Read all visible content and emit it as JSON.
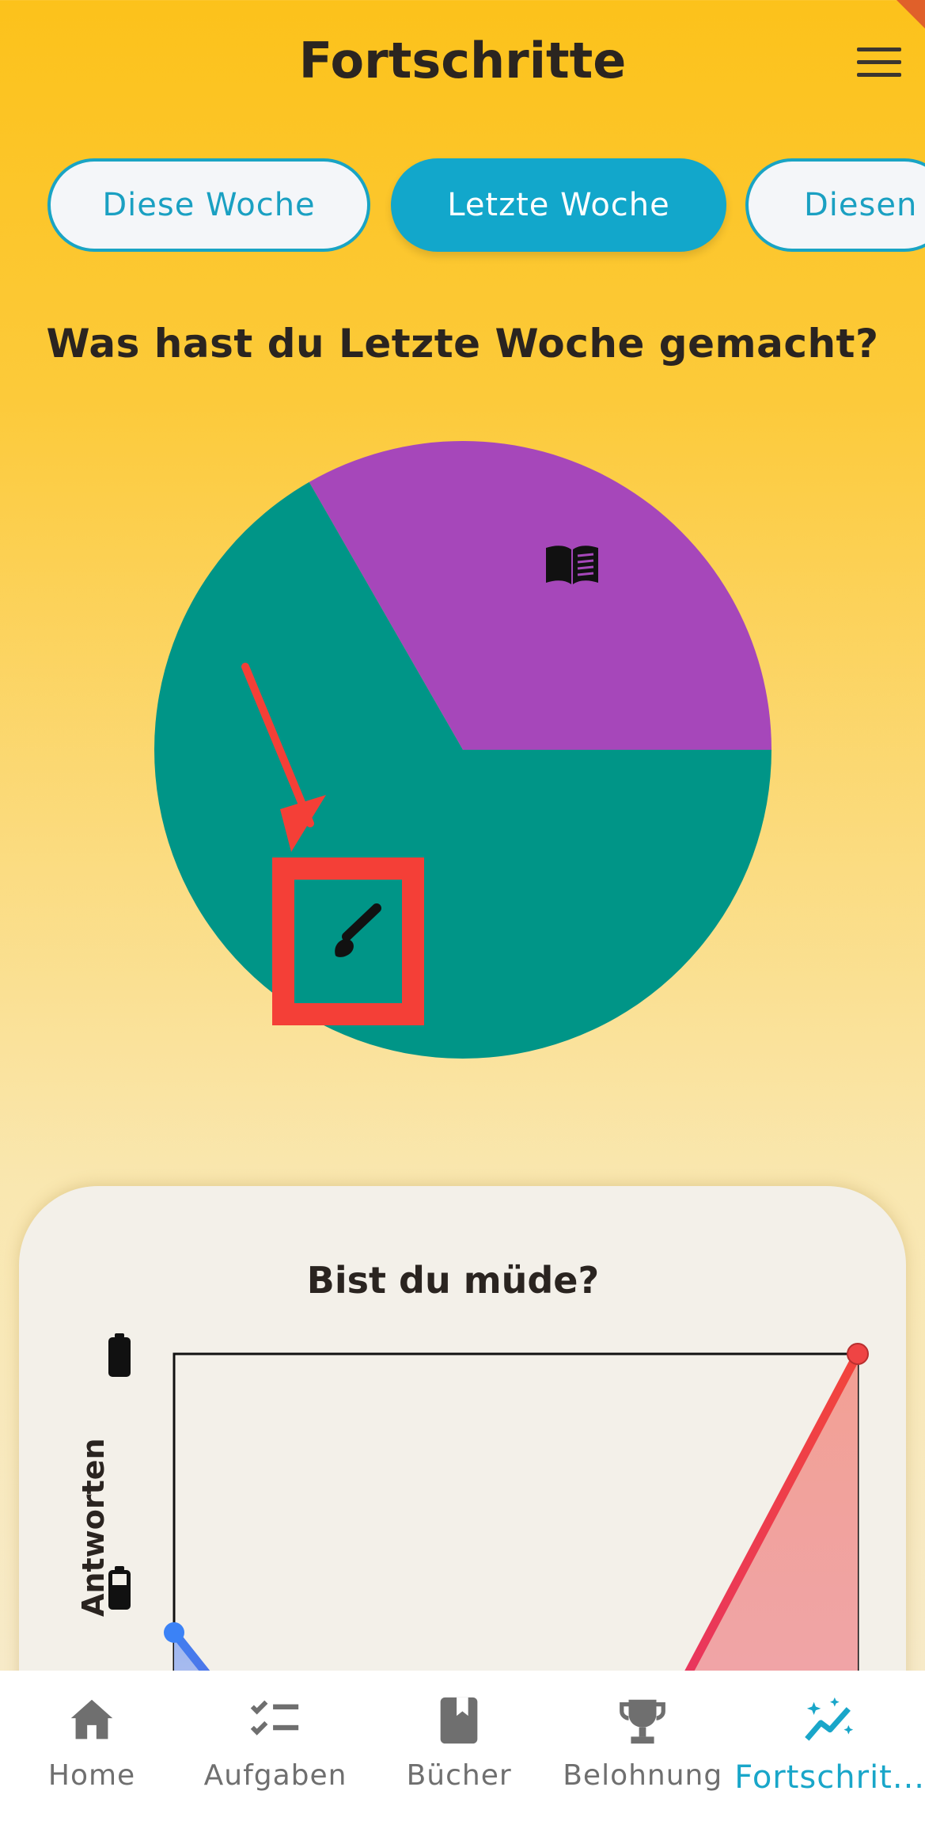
{
  "header": {
    "title": "Fortschritte"
  },
  "tabs": [
    {
      "label": "Diese Woche",
      "active": false
    },
    {
      "label": "Letzte Woche",
      "active": true
    },
    {
      "label": "Diesen",
      "active": false
    }
  ],
  "question": "Was hast du Letzte Woche gemacht?",
  "colors": {
    "pie_teal": "#009587",
    "pie_purple": "#a647ba",
    "highlight_red": "#f43f37",
    "accent": "#12a7cb"
  },
  "pie_icons": [
    "book-open-icon",
    "paintbrush-icon"
  ],
  "chart_data": [
    {
      "type": "pie",
      "slices": [
        {
          "icon": "book-open-icon",
          "value": 0.333,
          "color": "#a647ba"
        },
        {
          "icon": "paintbrush-icon",
          "value": 0.667,
          "color": "#009587"
        }
      ]
    },
    {
      "type": "line",
      "title": "Bist du müde?",
      "ylabel": "Antworten",
      "y_ticks": [
        "battery-full-icon",
        "battery-half-icon"
      ],
      "series": [
        {
          "color": "#3b82f6",
          "points": [
            [
              0,
              0.66
            ],
            [
              0.2,
              0.45
            ]
          ]
        },
        {
          "color": "#ef4444",
          "points": [
            [
              0.65,
              0.45
            ],
            [
              1,
              1
            ]
          ]
        }
      ]
    }
  ],
  "nav": [
    {
      "label": "Home",
      "icon": "home-icon",
      "active": false
    },
    {
      "label": "Aufgaben",
      "icon": "checklist-icon",
      "active": false
    },
    {
      "label": "Bücher",
      "icon": "book-icon",
      "active": false
    },
    {
      "label": "Belohnung",
      "icon": "trophy-icon",
      "active": false
    },
    {
      "label": "Fortschrit...",
      "icon": "progress-chart-icon",
      "active": true
    }
  ]
}
